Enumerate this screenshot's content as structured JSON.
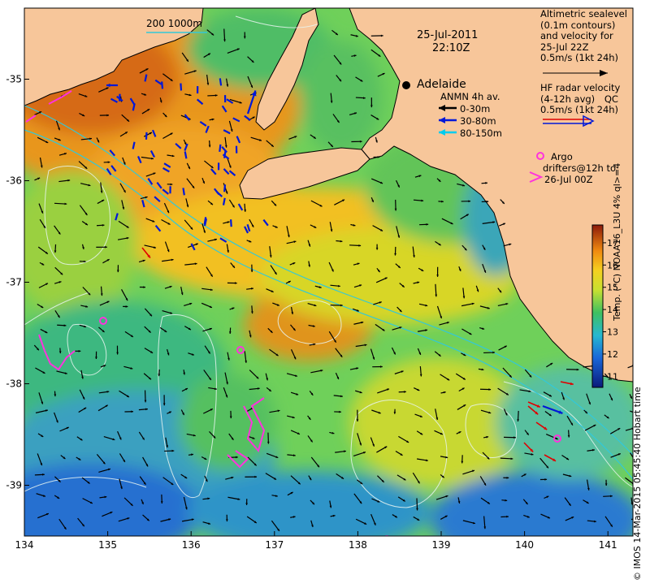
{
  "map": {
    "date": "25-Jul-2011",
    "time": "22:10Z",
    "scale_bar": "200 1000m",
    "city": "Adelaide",
    "lon_ticks": [
      134,
      135,
      136,
      137,
      138,
      139,
      140,
      141
    ],
    "lat_ticks": [
      -35,
      -36,
      -37,
      -38,
      -39
    ],
    "extent": {
      "lon_min": 134,
      "lon_max": 141.3,
      "lat_max": -34.3,
      "lat_min": -39.5
    }
  },
  "legend": {
    "altimetric": [
      "Altimetric sealevel",
      "(0.1m contours)",
      "and velocity for",
      "25-Jul 22Z",
      "0.5m/s (1kt 24h)"
    ],
    "hf_radar": [
      "HF radar velocity",
      "(4-12h avg)",
      "0.5m/s (1kt 24h)"
    ],
    "hf_qc": "QC",
    "anmn_title": "ANMN 4h av.",
    "anmn_items": [
      {
        "label": "0-30m",
        "color": "#000000"
      },
      {
        "label": "30-80m",
        "color": "#0000dd"
      },
      {
        "label": "80-150m",
        "color": "#00ccee"
      }
    ],
    "argo": [
      "Argo",
      "drifters@12h to",
      "26-Jul 00Z"
    ]
  },
  "colorbar": {
    "ticks": [
      11,
      12,
      13,
      14,
      15,
      16,
      17
    ],
    "min": 10.5,
    "max": 17.8,
    "label": "Temp. (°C) NOAA16_L3U 4% ql>=4"
  },
  "footer": "© IMOS 14-Mar-2015 05:45:40 Hobart time",
  "colors": {
    "land": "#f7c69a",
    "coast": "#000000",
    "contour": "#e8f4f0",
    "isobath": "#33c8d8",
    "argo": "#ff33dd"
  }
}
